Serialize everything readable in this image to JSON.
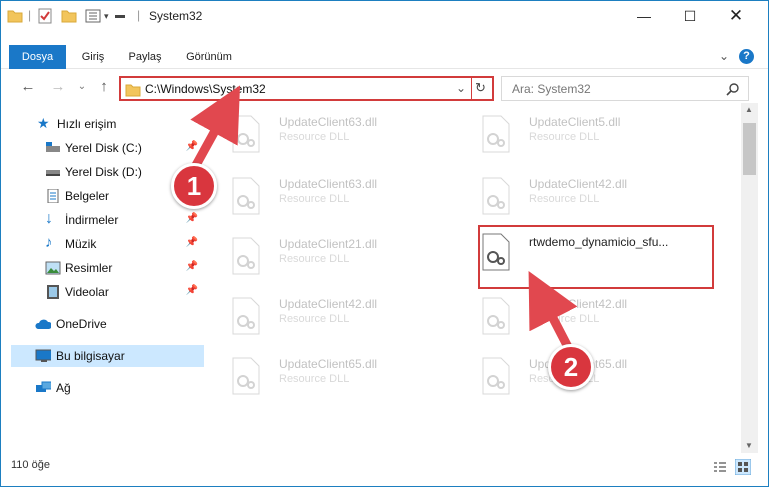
{
  "window": {
    "title": "System32"
  },
  "ribbon": {
    "tabs": [
      "Dosya",
      "Giriş",
      "Paylaş",
      "Görünüm"
    ]
  },
  "address": {
    "path": "C:\\Windows\\System32"
  },
  "search": {
    "placeholder": "Ara: System32"
  },
  "sidebar": {
    "items": [
      {
        "label": "Hızlı erişim"
      },
      {
        "label": "Yerel Disk (C:)"
      },
      {
        "label": "Yerel Disk (D:)"
      },
      {
        "label": "Belgeler"
      },
      {
        "label": "İndirmeler"
      },
      {
        "label": "Müzik"
      },
      {
        "label": "Resimler"
      },
      {
        "label": "Videolar"
      },
      {
        "label": "OneDrive"
      },
      {
        "label": "Bu bilgisayar"
      },
      {
        "label": "Ağ"
      }
    ]
  },
  "files": [
    {
      "name": "UpdateClient63.dll",
      "type": "Resource DLL"
    },
    {
      "name": "UpdateClient5.dll",
      "type": "Resource DLL"
    },
    {
      "name": "UpdateClient63.dll",
      "type": "Resource DLL"
    },
    {
      "name": "UpdateClient42.dll",
      "type": "Resource DLL"
    },
    {
      "name": "UpdateClient21.dll",
      "type": "Resource DLL"
    },
    {
      "name": "rtwdemo_dynamicio_sfu...",
      "type": ""
    },
    {
      "name": "UpdateClient42.dll",
      "type": "Resource DLL"
    },
    {
      "name": "UpdateClient42.dll",
      "type": "Resource DLL"
    },
    {
      "name": "UpdateClient65.dll",
      "type": "Resource DLL"
    },
    {
      "name": "UpdateClient65.dll",
      "type": "Resource DLL"
    }
  ],
  "status": {
    "count": "110 öğe"
  },
  "callouts": {
    "one": "1",
    "two": "2"
  },
  "colors": {
    "accent": "#1a78c8",
    "highlight": "#d23b3b"
  }
}
